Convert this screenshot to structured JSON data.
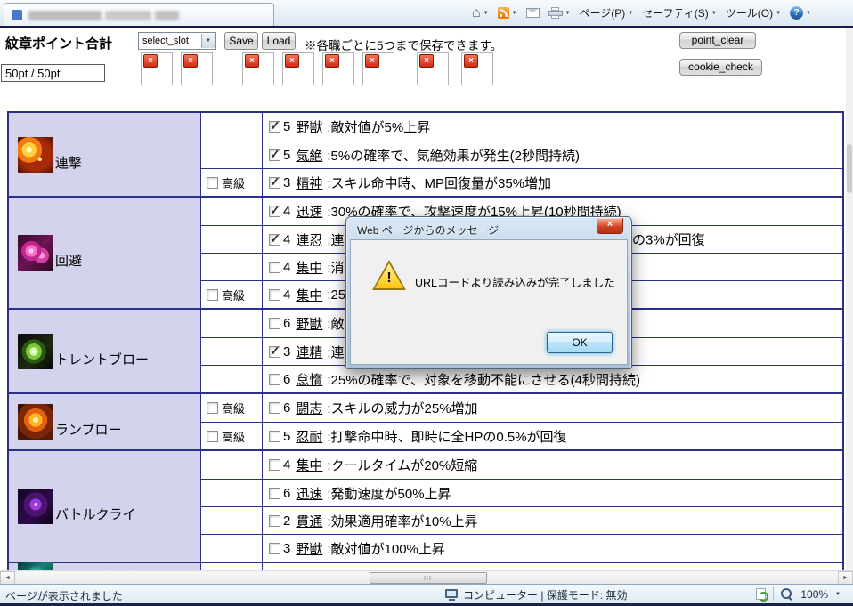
{
  "icons": {
    "home": "⌂",
    "dropdown": "▼",
    "close": "×",
    "check": "✓",
    "help": "?",
    "warning": "!",
    "scroll_left": "◄",
    "scroll_right": "►",
    "delete": "×"
  },
  "browser": {
    "menus": {
      "page": "ページ(P)",
      "safety": "セーフティ(S)",
      "tools": "ツール(O)"
    }
  },
  "header": {
    "title": "紋章ポイント合計",
    "slot_select": "select_slot",
    "save": "Save",
    "load": "Load",
    "note": "※各職ごとに5つまで保存できます。",
    "point_clear": "point_clear",
    "cookie_check": "cookie_check",
    "points": "50pt / 50pt"
  },
  "dialog": {
    "title": "Web ページからのメッセージ",
    "message": "URLコードより読み込みが完了しました",
    "ok": "OK"
  },
  "table": {
    "premium_label": "高級",
    "skills": [
      {
        "name": "連撃",
        "effects": [
          {
            "checked": true,
            "level": "5",
            "ename": "野獣",
            "desc": ":敵対値が5%上昇",
            "premium": false
          },
          {
            "checked": true,
            "level": "5",
            "ename": "気絶",
            "desc": ":5%の確率で、気絶効果が発生(2秒間持続)",
            "premium": false
          },
          {
            "checked": true,
            "level": "3",
            "ename": "精神",
            "desc": ":スキル命中時、MP回復量が35%増加",
            "premium": true
          }
        ]
      },
      {
        "name": "回避",
        "effects": [
          {
            "checked": true,
            "level": "4",
            "ename": "迅速",
            "desc": ":30%の確率で、攻撃速度が15%上昇(10秒間持続)",
            "premium": false
          },
          {
            "checked": true,
            "level": "4",
            "ename": "連忍",
            "desc": ":連",
            "tail": "の3%が回復",
            "premium": false
          },
          {
            "checked": false,
            "level": "4",
            "ename": "集中",
            "desc": ":消",
            "premium": false
          },
          {
            "checked": false,
            "level": "4",
            "ename": "集中",
            "desc": ":25",
            "premium": true
          }
        ]
      },
      {
        "name": "トレントブロー",
        "effects": [
          {
            "checked": false,
            "level": "6",
            "ename": "野獣",
            "desc": ":敵",
            "premium": false
          },
          {
            "checked": true,
            "level": "3",
            "ename": "連精",
            "desc": ":連",
            "premium": false
          },
          {
            "checked": false,
            "level": "6",
            "ename": "怠惰",
            "desc": ":25%の確率で、対象を移動不能にさせる(4秒間持続)",
            "premium": false
          }
        ]
      },
      {
        "name": "ランブロー",
        "effects": [
          {
            "checked": false,
            "level": "6",
            "ename": "闘志",
            "desc": ":スキルの威力が25%増加",
            "premium": true
          },
          {
            "checked": false,
            "level": "5",
            "ename": "忍耐",
            "desc": ":打撃命中時、即時に全HPの0.5%が回復",
            "premium": true
          }
        ]
      },
      {
        "name": "バトルクライ",
        "effects": [
          {
            "checked": false,
            "level": "4",
            "ename": "集中",
            "desc": ":クールタイムが20%短縮",
            "premium": false
          },
          {
            "checked": false,
            "level": "6",
            "ename": "迅速",
            "desc": ":発動速度が50%上昇",
            "premium": false
          },
          {
            "checked": false,
            "level": "2",
            "ename": "貫通",
            "desc": ":効果適用確率が10%上昇",
            "premium": false
          },
          {
            "checked": false,
            "level": "3",
            "ename": "野獣",
            "desc": ":敵対値が100%上昇",
            "premium": false
          }
        ]
      },
      {
        "name": "",
        "effects": []
      }
    ]
  },
  "statusbar": {
    "left": "ページが表示されました",
    "protection": "コンピューター | 保護モード: 無効",
    "zoom": "100%"
  },
  "colors": {
    "table_border": "#2b3188",
    "name_cell_bg": "#d3d3ed",
    "delete_red": "#d42a10",
    "dialog_frame": "#bcd0e5"
  }
}
